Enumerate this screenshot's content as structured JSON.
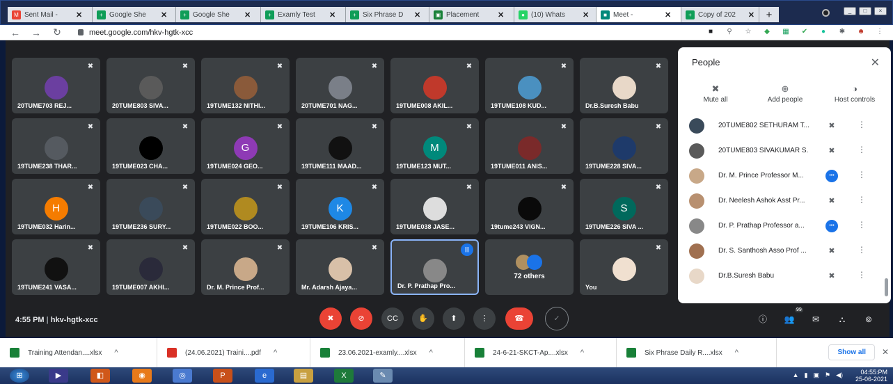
{
  "browser": {
    "tabs": [
      {
        "label": "Sent Mail -",
        "icon": "M",
        "color": "#ea4335"
      },
      {
        "label": "Google She",
        "icon": "+",
        "color": "#0f9d58"
      },
      {
        "label": "Google She",
        "icon": "+",
        "color": "#0f9d58"
      },
      {
        "label": "Examly Test",
        "icon": "+",
        "color": "#0f9d58"
      },
      {
        "label": "Six Phrase D",
        "icon": "+",
        "color": "#0f9d58"
      },
      {
        "label": "Placement",
        "icon": "▣",
        "color": "#188038"
      },
      {
        "label": "(10) Whats",
        "icon": "●",
        "color": "#25d366"
      },
      {
        "label": "Meet -",
        "icon": "■",
        "color": "#00897b"
      },
      {
        "label": "Copy of 202",
        "icon": "+",
        "color": "#0f9d58"
      }
    ],
    "new_tab": "+",
    "url": "meet.google.com/hkv-hgtk-xcc"
  },
  "tiles": [
    {
      "name": "20TUME703 REJ...",
      "avatar": "#6b3fa0"
    },
    {
      "name": "20TUME803 SIVA...",
      "avatar": "#5a5a5a"
    },
    {
      "name": "19TUME132 NITHI...",
      "avatar": "#8a5a3a"
    },
    {
      "name": "20TUME701 NAG...",
      "avatar": "#7a7f88"
    },
    {
      "name": "19TUME008 AKIL...",
      "avatar": "#c0392b"
    },
    {
      "name": "19TUME108 KUD...",
      "avatar": "#4a90c0"
    },
    {
      "name": "Dr.B.Suresh Babu",
      "avatar": "#e8d8c8"
    },
    {
      "name": "19TUME238 THAR...",
      "avatar": "#555a60"
    },
    {
      "name": "19TUME023 CHA...",
      "avatar": "#000000"
    },
    {
      "name": "19TUME024 GEO...",
      "avatar": "#8e3ab5",
      "letter": "G"
    },
    {
      "name": "19TUME111 MAAD...",
      "avatar": "#111111"
    },
    {
      "name": "19TUME123 MUT...",
      "avatar": "#00897b",
      "letter": "M"
    },
    {
      "name": "19TUME011 ANIS...",
      "avatar": "#7a2a2a"
    },
    {
      "name": "19TUME228 SIVA...",
      "avatar": "#1e3a6a"
    },
    {
      "name": "19TUME032 Harin...",
      "avatar": "#f57c00",
      "letter": "H"
    },
    {
      "name": "19TUME236 SURY...",
      "avatar": "#3a4a5a"
    },
    {
      "name": "19TUME022 BOO...",
      "avatar": "#b08a20"
    },
    {
      "name": "19TUME106 KRIS...",
      "avatar": "#1e88e5",
      "letter": "K"
    },
    {
      "name": "19TUME038 JASE...",
      "avatar": "#dddddd"
    },
    {
      "name": "19tume243 VIGN...",
      "avatar": "#0a0a0a"
    },
    {
      "name": "19TUME226 SIVA ...",
      "avatar": "#00695c",
      "letter": "S"
    },
    {
      "name": "19TUME241 VASA...",
      "avatar": "#111111"
    },
    {
      "name": "19TUME007 AKHI...",
      "avatar": "#2a2a3a"
    },
    {
      "name": "Dr. M. Prince Prof...",
      "avatar": "#c8a888"
    },
    {
      "name": "Mr. Adarsh Ajaya...",
      "avatar": "#d8c0a8"
    },
    {
      "name": "Dr. P. Prathap Pro...",
      "avatar": "#888888",
      "active": true
    },
    {
      "others": "72 others"
    },
    {
      "name": "You",
      "avatar": "#f0e0d0"
    }
  ],
  "people_panel": {
    "title": "People",
    "actions": [
      {
        "icon": "mic-off-icon",
        "label": "Mute all",
        "glyph": "✖"
      },
      {
        "icon": "add-person-icon",
        "label": "Add people",
        "glyph": "⊕"
      },
      {
        "icon": "toggle-icon",
        "label": "Host controls",
        "glyph": "◑"
      }
    ],
    "participants": [
      {
        "name": "20TUME802 SETHURAM T...",
        "mic": "✖",
        "avatar": "#3a4a5a"
      },
      {
        "name": "20TUME803 SIVAKUMAR S.",
        "mic": "✖",
        "avatar": "#5a5a5a"
      },
      {
        "name": "Dr. M. Prince Professor M...",
        "mic": "•••",
        "speaking": true,
        "avatar": "#c8a888"
      },
      {
        "name": "Dr. Neelesh Ashok Asst Pr...",
        "mic": "✖",
        "avatar": "#b89070"
      },
      {
        "name": "Dr. P. Prathap Professor a...",
        "mic": "•••",
        "speaking": true,
        "avatar": "#888888"
      },
      {
        "name": "Dr. S. Santhosh Asso Prof ...",
        "mic": "✖",
        "avatar": "#a07050"
      },
      {
        "name": "Dr.B.Suresh Babu",
        "mic": "✖",
        "avatar": "#e8d8c8"
      }
    ]
  },
  "meeting": {
    "time": "4:55 PM",
    "code": "hkv-hgtk-xcc",
    "participant_badge": "99"
  },
  "downloads": [
    {
      "name": "Training Attendan....xlsx",
      "color": "#188038"
    },
    {
      "name": "(24.06.2021) Traini....pdf",
      "color": "#d93025"
    },
    {
      "name": "23.06.2021-examly....xlsx",
      "color": "#188038"
    },
    {
      "name": "24-6-21-SKCT-Ap....xlsx",
      "color": "#188038"
    },
    {
      "name": "Six Phrase Daily R....xlsx",
      "color": "#188038"
    }
  ],
  "show_all": "Show all",
  "clock": {
    "time": "04:55:PM",
    "date": "25-06-2021"
  }
}
